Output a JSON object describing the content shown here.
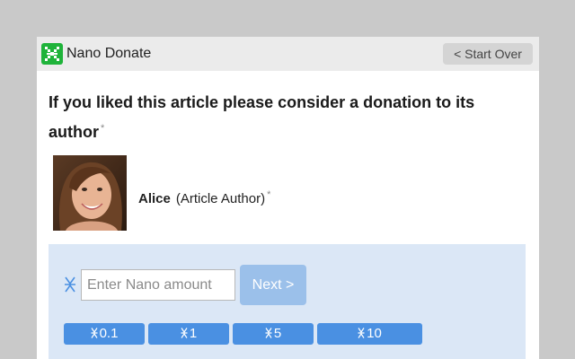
{
  "header": {
    "brand": "Nano Donate",
    "start_over_label": "< Start Over"
  },
  "headline": "If you liked this article please consider a donation to its author",
  "asterisk": "*",
  "author": {
    "name": "Alice",
    "role": "(Article Author)"
  },
  "donation": {
    "currency_icon": "nano-icon",
    "amount_placeholder": "Enter Nano amount",
    "next_label": "Next >",
    "presets": [
      "0.1",
      "1",
      "5",
      "10"
    ]
  },
  "colors": {
    "accent": "#4a90e2",
    "next_disabled": "#9bc0ea",
    "donate_bg": "#dbe7f6",
    "logo_green": "#1fb33a"
  }
}
